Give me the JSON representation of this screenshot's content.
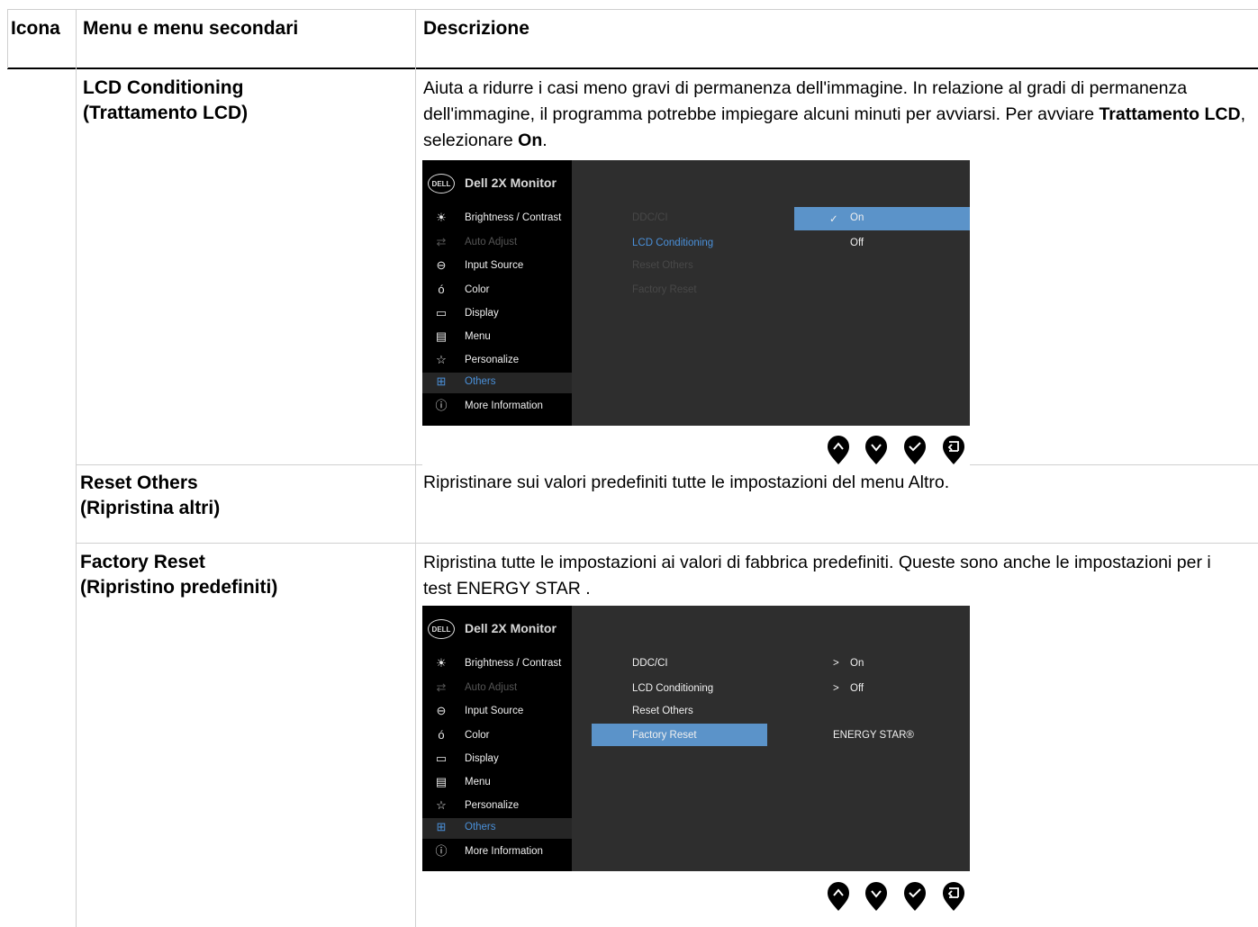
{
  "header": {
    "col_icon": "Icona",
    "col_menu": "Menu e menu secondari",
    "col_desc": "Descrizione"
  },
  "rows": [
    {
      "menu_line1": "LCD Conditioning",
      "menu_line2": "(Trattamento LCD)",
      "desc_part1": "Aiuta a ridurre i casi meno gravi di permanenza dell'immagine. In relazione al gradi di permanenza dell'immagine, il programma potrebbe impiegare alcuni minuti per avviarsi. Per avviare ",
      "desc_bold1": "Trattamento LCD",
      "desc_part2": ", selezionare ",
      "desc_bold2": "On",
      "desc_part3": "."
    },
    {
      "menu_line1": "Reset Others",
      "menu_line2": "(Ripristina altri)",
      "desc": "Ripristinare sui valori predefiniti tutte le impostazioni del menu Altro."
    },
    {
      "menu_line1": "Factory Reset",
      "menu_line2": "(Ripristino predefiniti)",
      "desc": "Ripristina tutte le impostazioni ai valori di fabbrica predefiniti. Queste sono anche le impostazioni per i test ENERGY STAR ."
    }
  ],
  "osd": {
    "logo": "DELL",
    "title": "Dell 2X Monitor",
    "menu_items": [
      {
        "label": "Brightness / Contrast",
        "icon": "brightness-icon"
      },
      {
        "label": "Auto Adjust",
        "icon": "auto-adjust-icon"
      },
      {
        "label": "Input Source",
        "icon": "input-source-icon"
      },
      {
        "label": "Color",
        "icon": "color-icon"
      },
      {
        "label": "Display",
        "icon": "display-icon"
      },
      {
        "label": "Menu",
        "icon": "menu-icon"
      },
      {
        "label": "Personalize",
        "icon": "star-icon"
      },
      {
        "label": "Others",
        "icon": "others-icon"
      },
      {
        "label": "More Information",
        "icon": "info-icon"
      }
    ],
    "submenu": [
      "DDC/CI",
      "LCD Conditioning",
      "Reset Others",
      "Factory Reset"
    ],
    "osd1_options": {
      "on": "On",
      "off": "Off"
    },
    "osd2_values": {
      "ddcci": "On",
      "lcd": "Off",
      "factory": "ENERGY STAR®"
    },
    "arrow": ">",
    "check": "✓"
  },
  "colors": {
    "osd_bg": "#2e2e2e",
    "osd_left_bg": "#000000",
    "osd_highlight": "#5b93c9",
    "osd_selected_text": "#4a90d9"
  }
}
